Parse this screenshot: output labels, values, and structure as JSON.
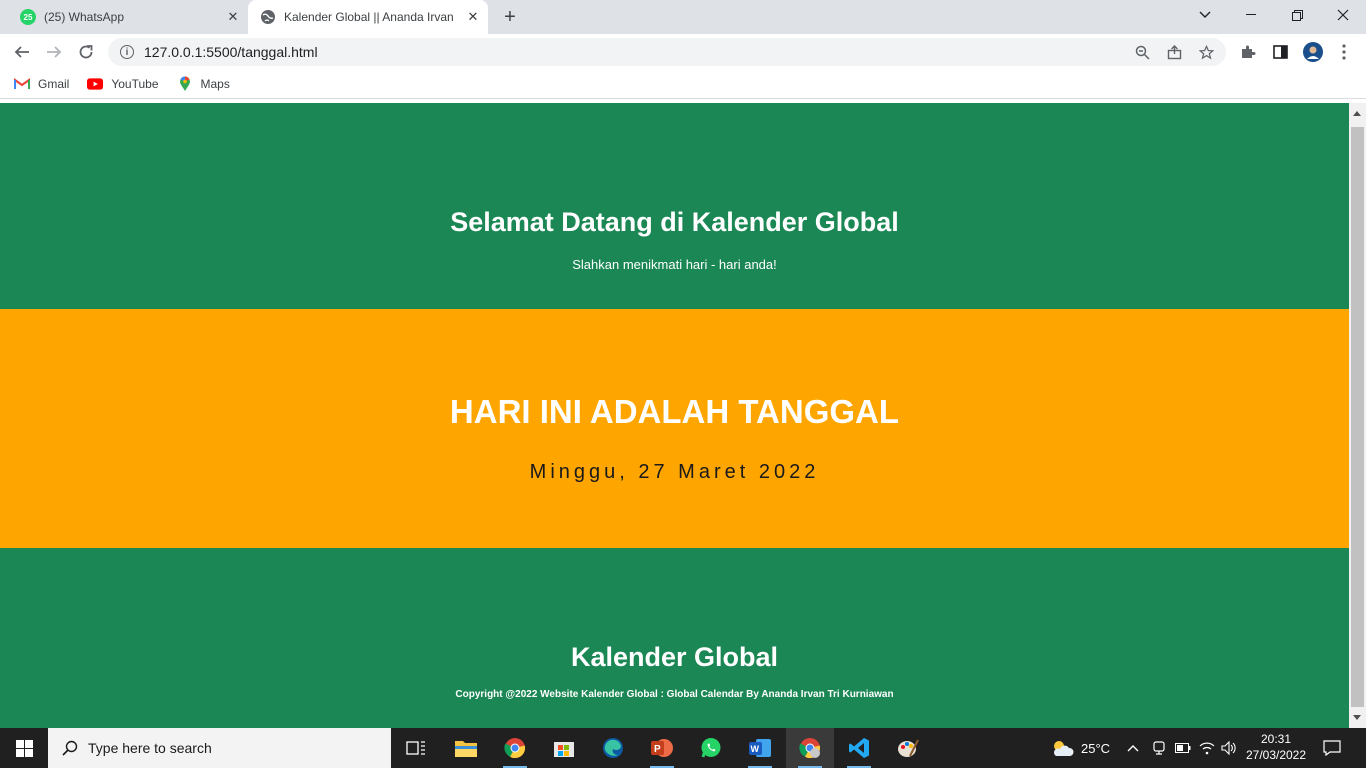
{
  "browser": {
    "tabs": [
      {
        "title": "(25) WhatsApp",
        "badge": "25"
      },
      {
        "title": "Kalender Global || Ananda Irvan"
      }
    ],
    "url": "127.0.0.1:5500/tanggal.html",
    "bookmarks": [
      {
        "label": "Gmail"
      },
      {
        "label": "YouTube"
      },
      {
        "label": "Maps"
      }
    ]
  },
  "page": {
    "header": {
      "title": "Selamat Datang di Kalender Global",
      "subtitle": "Slahkan menikmati hari - hari anda!"
    },
    "main": {
      "heading": "HARI INI ADALAH TANGGAL",
      "date": "Minggu, 27 Maret 2022"
    },
    "footer": {
      "title": "Kalender Global",
      "copyright": "Copyright @2022 Website Kalender Global : Global Calendar By Ananda Irvan Tri Kurniawan"
    },
    "colors": {
      "green": "#1a8754",
      "orange": "#ffa500"
    }
  },
  "taskbar": {
    "search_placeholder": "Type here to search",
    "weather": "25°C",
    "time": "20:31",
    "date": "27/03/2022"
  }
}
